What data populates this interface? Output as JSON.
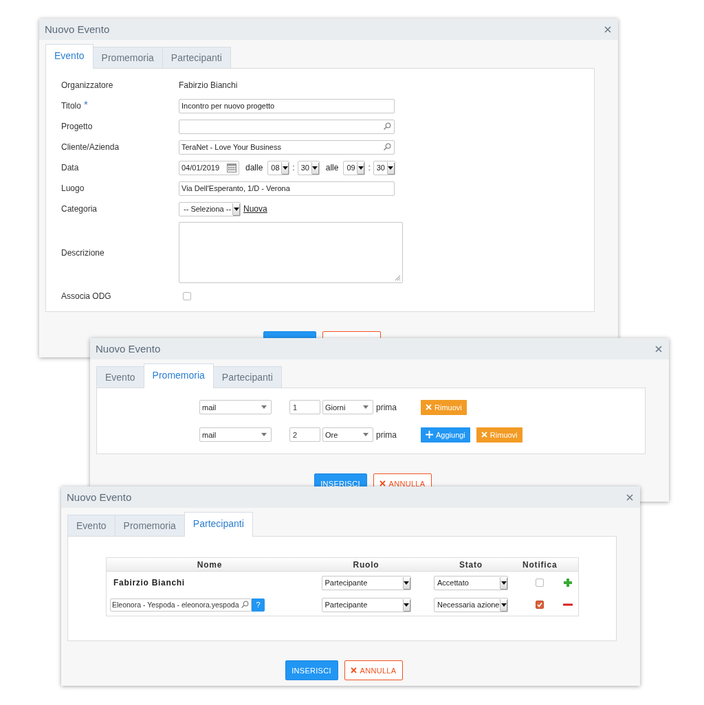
{
  "windows": [
    {
      "title": "Nuovo Evento",
      "tabs": [
        {
          "label": "Evento",
          "selected": true
        },
        {
          "label": "Promemoria",
          "selected": false
        },
        {
          "label": "Partecipanti",
          "selected": false
        }
      ],
      "content": {
        "kind": "event_form",
        "rows": [
          {
            "kind": "text",
            "label": "Organizzatore",
            "value": "Fabirzio Bianchi"
          },
          {
            "kind": "input",
            "label": "Titolo",
            "required_mark": "*",
            "value": "Incontro per nuovo progetto"
          },
          {
            "kind": "lookup",
            "label": "Progetto"
          },
          {
            "kind": "lookup",
            "label": "Cliente/Azienda",
            "value": "TeraNet - Love Your Business"
          },
          {
            "kind": "datetime",
            "label": "Data",
            "date": "04/01/2019",
            "from_label": "dalle",
            "from_hour": "08",
            "from_separator": ":",
            "from_minute": "30",
            "to_label": "alle",
            "to_hour": "09",
            "to_separator": ":",
            "to_minute": "30"
          },
          {
            "kind": "input",
            "label": "Luogo",
            "value": "Via Dell'Esperanto, 1/D - Verona"
          },
          {
            "kind": "select",
            "label": "Categoria",
            "value": "-- Seleziona --",
            "link": "Nuova"
          },
          {
            "kind": "textarea",
            "label": "Descrizione"
          },
          {
            "kind": "checkbox",
            "label": "Associa ODG",
            "checked": false
          }
        ]
      },
      "buttons": [
        {
          "kind": "primary"
        },
        {
          "kind": "cancel"
        }
      ]
    },
    {
      "title": "Nuovo Evento",
      "tabs": [
        {
          "label": "Evento",
          "selected": false
        },
        {
          "label": "Promemoria",
          "selected": true
        },
        {
          "label": "Partecipanti",
          "selected": false
        }
      ],
      "content": {
        "kind": "reminders",
        "rows": [
          {
            "channel": "mail",
            "amount": "1",
            "unit": "Giorni",
            "suffix": "prima",
            "actions": [
              {
                "kind": "remove",
                "label": "Rimuovi"
              }
            ]
          },
          {
            "channel": "mail",
            "amount": "2",
            "unit": "Ore",
            "suffix": "prima",
            "actions": [
              {
                "kind": "add",
                "label": "Aggiungi"
              },
              {
                "kind": "remove",
                "label": "Rimuovi"
              }
            ]
          }
        ]
      },
      "buttons": [
        {
          "kind": "primary",
          "label": "INSERISCI"
        },
        {
          "kind": "cancel",
          "label": "ANNULLA"
        }
      ]
    },
    {
      "title": "Nuovo Evento",
      "tabs": [
        {
          "label": "Evento",
          "selected": false
        },
        {
          "label": "Promemoria",
          "selected": false
        },
        {
          "label": "Partecipanti",
          "selected": true
        }
      ],
      "content": {
        "kind": "participants",
        "columns": [
          "Nome",
          "Ruolo",
          "Stato",
          "Notifica"
        ],
        "rows": [
          {
            "kind": "organizer",
            "name": "Fabirzio Bianchi",
            "role": "Partecipante",
            "status": "Accettato",
            "notify": false,
            "action": {
              "kind": "add"
            }
          },
          {
            "kind": "search",
            "name": "Eleonora - Yespoda - eleonora.yespoda",
            "help": "?",
            "role": "Partecipante",
            "status": "Necessaria azione",
            "notify": true,
            "action": {
              "kind": "remove"
            }
          }
        ]
      },
      "buttons": [
        {
          "kind": "primary",
          "label": "INSERISCI"
        },
        {
          "kind": "cancel",
          "label": "ANNULLA"
        }
      ]
    }
  ]
}
